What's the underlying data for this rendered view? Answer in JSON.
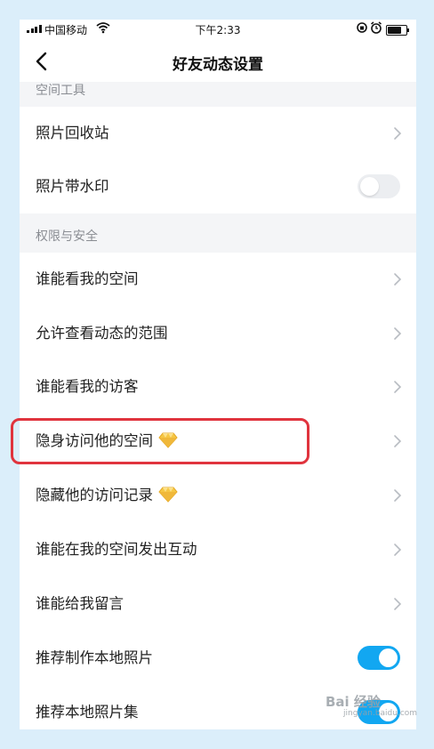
{
  "status_bar": {
    "carrier": "中国移动",
    "time": "下午2:33"
  },
  "nav": {
    "title": "好友动态设置"
  },
  "sections": [
    {
      "header": "空间工具"
    },
    {
      "header": "权限与安全"
    }
  ],
  "rows": [
    {
      "label": "照片回收站",
      "control": "chevron"
    },
    {
      "label": "照片带水印",
      "control": "toggle",
      "on": false
    },
    {
      "label": "谁能看我的空间",
      "control": "chevron"
    },
    {
      "label": "允许查看动态的范围",
      "control": "chevron"
    },
    {
      "label": "谁能看我的访客",
      "control": "chevron"
    },
    {
      "label": "隐身访问他的空间",
      "control": "chevron",
      "badge": "diamond-icon"
    },
    {
      "label": "隐藏他的访问记录",
      "control": "chevron",
      "badge": "diamond-icon"
    },
    {
      "label": "谁能在我的空间发出互动",
      "control": "chevron"
    },
    {
      "label": "谁能给我留言",
      "control": "chevron"
    },
    {
      "label": "推荐制作本地照片",
      "control": "toggle",
      "on": true
    },
    {
      "label": "推荐本地照片集",
      "control": "toggle",
      "on": true
    }
  ],
  "colors": {
    "toggle_on": "#12a7f1",
    "highlight": "#e0343e",
    "section_bg": "#f4f5f7"
  },
  "watermark": {
    "text": "Bai 经验",
    "sub": "jingyan.baidu.com"
  }
}
